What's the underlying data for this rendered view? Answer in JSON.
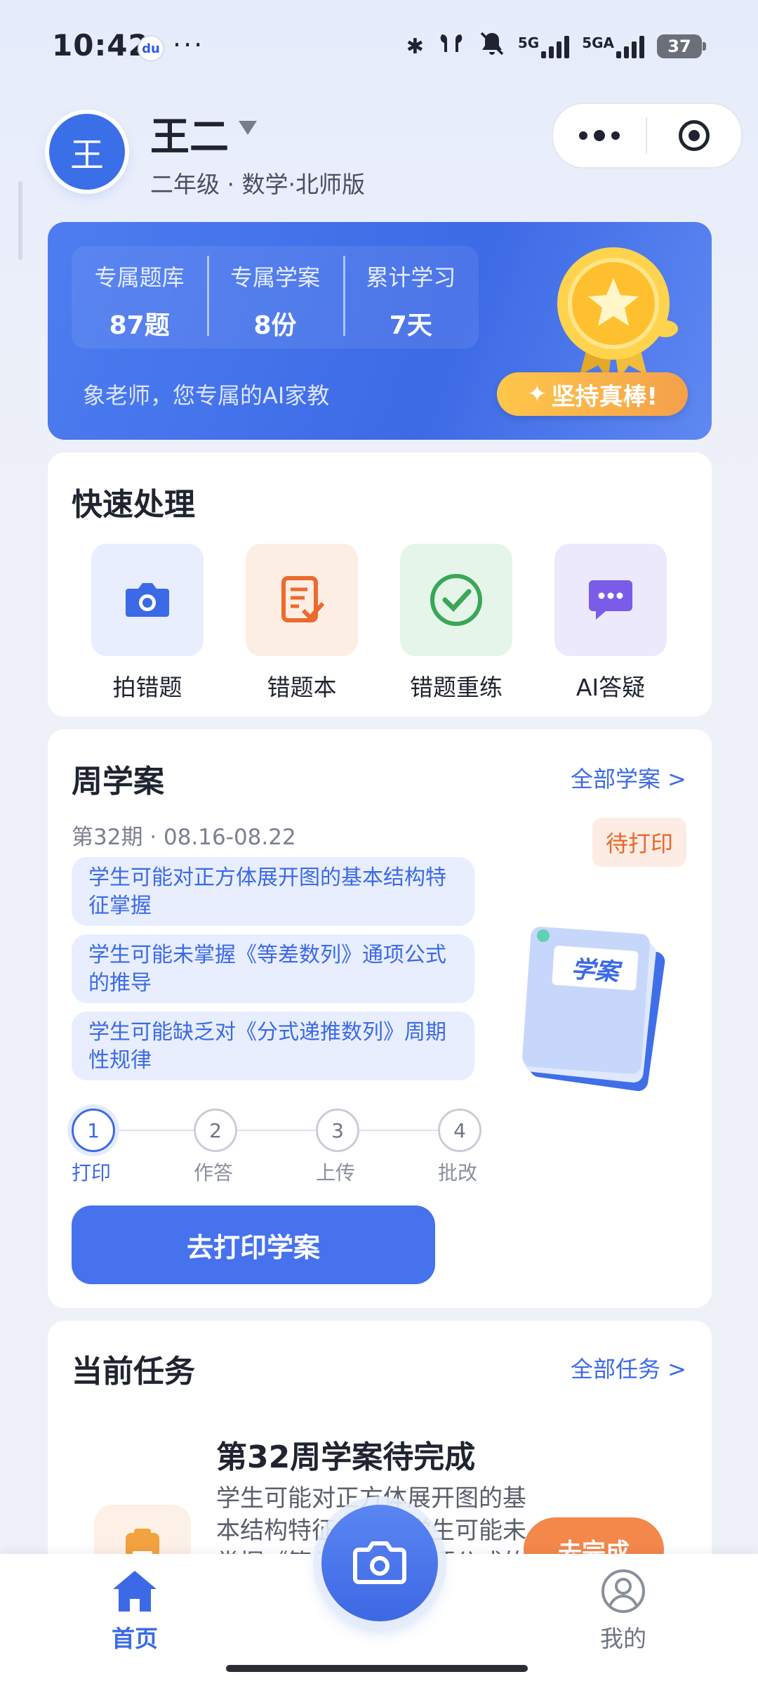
{
  "status_bar": {
    "time": "10:42",
    "baidu_badge": "du",
    "more": "···",
    "bt": "✱",
    "net1": "5G",
    "net2": "5GA",
    "battery": "37"
  },
  "header": {
    "avatar_text": "王",
    "user_name": "王二",
    "subtitle": "二年级 · 数学·北师版"
  },
  "hero": {
    "stats": [
      {
        "label": "专属题库",
        "value": "87题"
      },
      {
        "label": "专属学案",
        "value": "8份"
      },
      {
        "label": "累计学习",
        "value": "7天"
      }
    ],
    "tagline": "象老师，您专属的AI家教",
    "badge_text": "坚持真棒!"
  },
  "quick": {
    "title": "快速处理",
    "items": [
      {
        "label": "拍错题",
        "icon": "camera-icon",
        "bg": "#e8eefd",
        "color": "#3c6ae6"
      },
      {
        "label": "错题本",
        "icon": "notebook-icon",
        "bg": "#fdeee4",
        "color": "#ec6a2c"
      },
      {
        "label": "错题重练",
        "icon": "check-circle-icon",
        "bg": "#e6f5ea",
        "color": "#3aa657"
      },
      {
        "label": "AI答疑",
        "icon": "chat-bubble-icon",
        "bg": "#ede9fc",
        "color": "#7b5ce8"
      }
    ]
  },
  "weekly": {
    "title": "周学案",
    "link": "全部学案 >",
    "period": "第32期 · 08.16-08.22",
    "status": "待打印",
    "points": [
      "学生可能对正方体展开图的基本结构特征掌握",
      "学生可能未掌握《等差数列》通项公式的推导",
      "学生可能缺乏对《分式递推数列》周期性规律"
    ],
    "illustration_label": "学案",
    "steps": [
      {
        "num": "1",
        "label": "打印"
      },
      {
        "num": "2",
        "label": "作答"
      },
      {
        "num": "3",
        "label": "上传"
      },
      {
        "num": "4",
        "label": "批改"
      }
    ],
    "button": "去打印学案"
  },
  "tasks": {
    "title": "当前任务",
    "link": "全部任务 >",
    "task_title": "第32周学案待完成",
    "task_desc": "学生可能对正方体展开图的基本结构特征掌握，学生可能未掌握《等差数列》通项公式的推导",
    "button": "去完成"
  },
  "tabbar": {
    "home": "首页",
    "mine": "我的"
  },
  "colors": {
    "primary": "#3c6ae6",
    "orange": "#f4874a"
  }
}
